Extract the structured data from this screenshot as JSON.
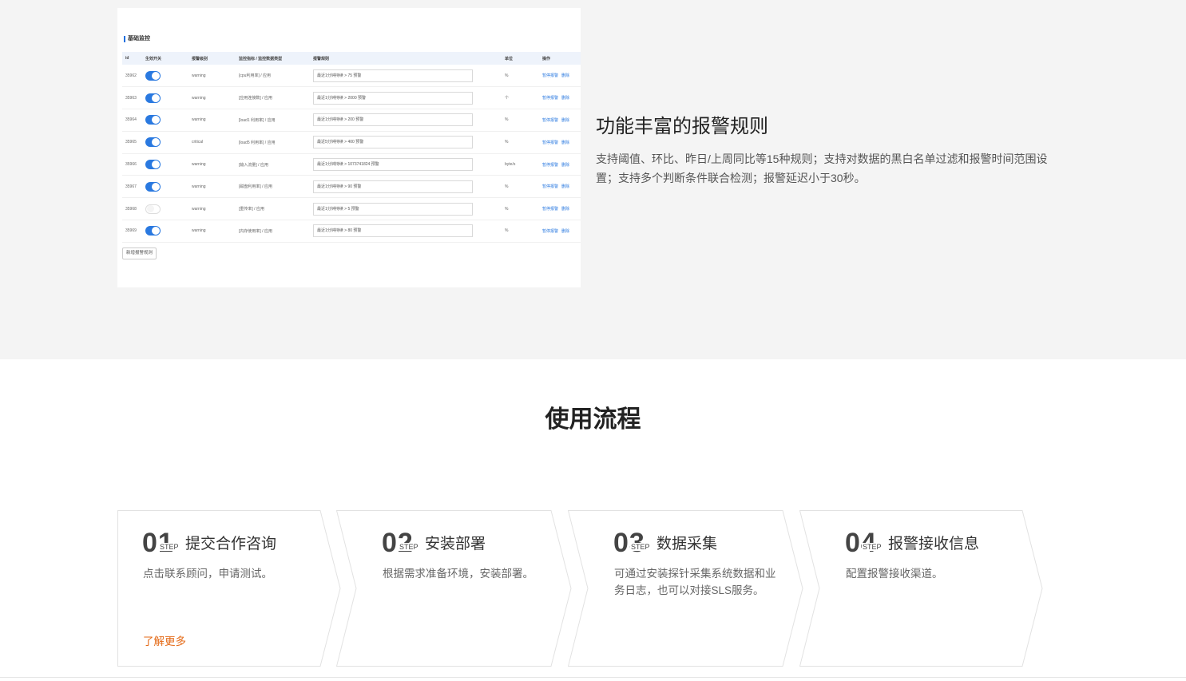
{
  "screenshot": {
    "panel_title": "基础监控",
    "columns": [
      "id",
      "生效开关",
      "报警级别",
      "监控指标 / 监控数据类型",
      "报警规则",
      "单位",
      "操作"
    ],
    "rows": [
      {
        "id": "35962",
        "enabled": true,
        "level": "warning",
        "metric": "[cpu利用率] / 应用",
        "rule": "最近1分钟持续 > 75 预警",
        "unit": "%"
      },
      {
        "id": "35963",
        "enabled": true,
        "level": "warning",
        "metric": "[应用连接数] / 应用",
        "rule": "最近1分钟持续 > 2000 预警",
        "unit": "个"
      },
      {
        "id": "35964",
        "enabled": true,
        "level": "warning",
        "metric": "[load1 利用率] / 应用",
        "rule": "最近1分钟持续 > 200 预警",
        "unit": "%"
      },
      {
        "id": "35965",
        "enabled": true,
        "level": "critical",
        "metric": "[load5 利用率] / 应用",
        "rule": "最近5分钟持续 > 400 预警",
        "unit": "%"
      },
      {
        "id": "35966",
        "enabled": true,
        "level": "warning",
        "metric": "[输入流量] / 应用",
        "rule": "最近1分钟持续 > 1073741824 预警",
        "unit": "byte/s"
      },
      {
        "id": "35967",
        "enabled": true,
        "level": "warning",
        "metric": "[磁盘利用率] / 应用",
        "rule": "最近1分钟持续 > 90 预警",
        "unit": "%"
      },
      {
        "id": "35968",
        "enabled": false,
        "level": "warning",
        "metric": "[重传率] / 应用",
        "rule": "最近1分钟持续 > 5 预警",
        "unit": "%"
      },
      {
        "id": "35969",
        "enabled": true,
        "level": "warning",
        "metric": "[内存使用率] / 应用",
        "rule": "最近1分钟持续 > 80 预警",
        "unit": "%"
      }
    ],
    "op_edit": "暂停报警",
    "op_delete": "删除",
    "add_button": "新增报警规则"
  },
  "feature": {
    "title": "功能丰富的报警规则",
    "description": "支持阈值、环比、昨日/上周同比等15种规则；支持对数据的黑白名单过滤和报警时间范围设置；支持多个判断条件联合检测；报警延迟小于30秒。"
  },
  "process": {
    "title": "使用流程",
    "step_word": "STEP",
    "steps": [
      {
        "num": "01",
        "title": "提交合作咨询",
        "desc": "点击联系顾问，申请测试。",
        "link": "了解更多"
      },
      {
        "num": "02",
        "title": "安装部署",
        "desc": "根据需求准备环境，安装部署。"
      },
      {
        "num": "03",
        "title": "数据采集",
        "desc": "可通过安装探针采集系统数据和业务日志，也可以对接SLS服务。"
      },
      {
        "num": "04",
        "title": "报警接收信息",
        "desc": "配置报警接收渠道。"
      }
    ]
  },
  "colors": {
    "accent": "#2a79e0",
    "link": "#e46a17",
    "feature_bg": "#f4f4f4"
  }
}
